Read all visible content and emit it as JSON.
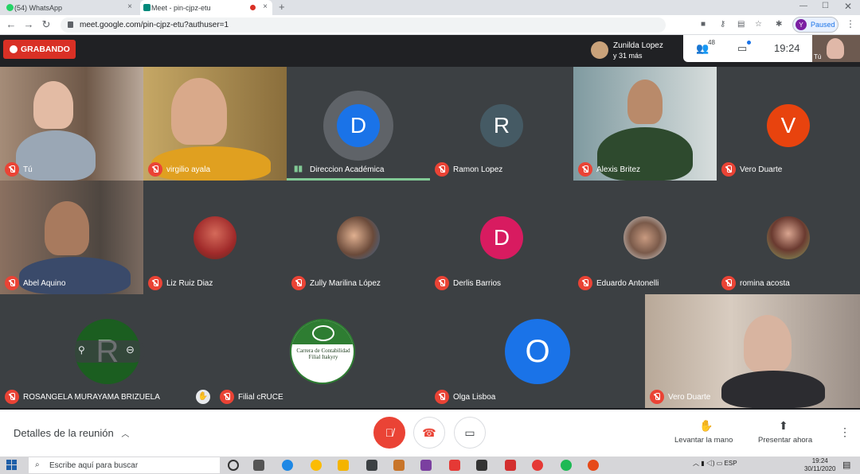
{
  "browser": {
    "tabs": [
      {
        "label": "(54) WhatsApp",
        "color": "#25d366"
      },
      {
        "label": "Meet - pin-cjpz-etu",
        "color": "#00897b"
      }
    ],
    "url": "meet.google.com/pin-cjpz-etu?authuser=1",
    "profile_initial": "Y",
    "profile_status": "Paused"
  },
  "meet": {
    "recording_label": "GRABANDO",
    "presenter_line1": "Zunilda Lopez",
    "presenter_line2": "y 31 más",
    "participant_count": "48",
    "time": "19:24",
    "self_label": "Tú",
    "tiles": [
      {
        "name": "Tú",
        "type": "video"
      },
      {
        "name": "virgilio ayala",
        "type": "video"
      },
      {
        "name": "Direccion Académica",
        "type": "letter",
        "letter": "D",
        "color": "#1a73e8",
        "speaking": true
      },
      {
        "name": "Ramon Lopez",
        "type": "letter",
        "letter": "R",
        "color": "#455a64"
      },
      {
        "name": "Alexis Britez",
        "type": "video"
      },
      {
        "name": "Vero Duarte",
        "type": "letter",
        "letter": "V",
        "color": "#e8430e"
      },
      {
        "name": "Abel Aquino",
        "type": "video"
      },
      {
        "name": "Liz Ruiz Diaz",
        "type": "photo"
      },
      {
        "name": "Zully Marilina López",
        "type": "photo"
      },
      {
        "name": "Derlis Barrios",
        "type": "letter",
        "letter": "D",
        "color": "#d81b60"
      },
      {
        "name": "Eduardo Antonelli",
        "type": "photo"
      },
      {
        "name": "romina acosta",
        "type": "photo"
      },
      {
        "name": "ROSANGELA MURAYAMA BRIZUELA",
        "type": "letter",
        "letter": "R",
        "color": "#1b5e20"
      },
      {
        "name": "Filial cRUCE",
        "type": "logo",
        "logo_text": "Carrera de Contabilidad Filial Itakyry"
      },
      {
        "name": "Olga Lisboa",
        "type": "letter",
        "letter": "O",
        "color": "#1a73e8"
      },
      {
        "name": "Vero Duarte",
        "type": "video"
      }
    ]
  },
  "bottom": {
    "details_label": "Detalles de la reunión",
    "raise_hand": "Levantar la mano",
    "present_now": "Presentar ahora"
  },
  "taskbar": {
    "search_placeholder": "Escribe aquí para buscar",
    "lang": "ESP",
    "time": "19:24",
    "date": "30/11/2020"
  }
}
